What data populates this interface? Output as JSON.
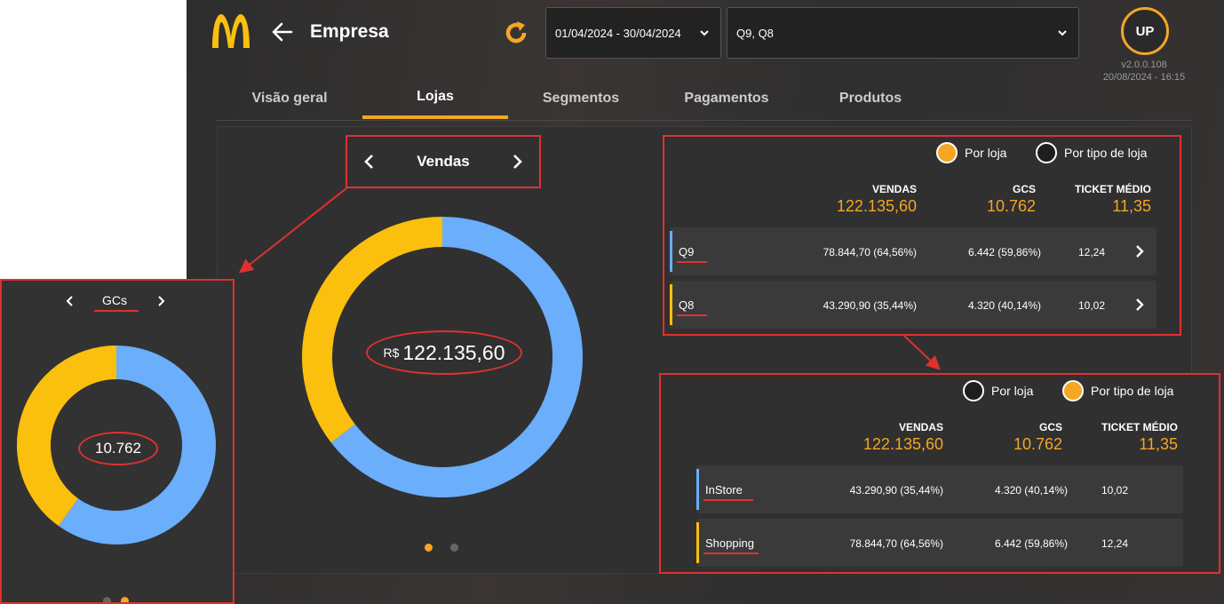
{
  "header": {
    "title": "Empresa",
    "date_range": "01/04/2024 - 30/04/2024",
    "stores": "Q9, Q8",
    "avatar": "UP",
    "version": "v2.0.0.108",
    "timestamp": "20/08/2024 - 16:15"
  },
  "tabs": [
    {
      "label": "Visão geral"
    },
    {
      "label": "Lojas"
    },
    {
      "label": "Segmentos"
    },
    {
      "label": "Pagamentos"
    },
    {
      "label": "Produtos"
    }
  ],
  "metric": {
    "label": "Vendas",
    "currency": "R$",
    "total": "122.135,60"
  },
  "inset": {
    "label": "GCs",
    "total": "10.762"
  },
  "chart_data": [
    {
      "type": "pie",
      "categories": [
        "Q9",
        "Q8"
      ],
      "values": [
        64.56,
        35.44
      ],
      "colors": [
        "#6aaefc",
        "#fbbf0e"
      ]
    },
    {
      "type": "pie",
      "categories": [
        "Q9",
        "Q8"
      ],
      "values": [
        59.86,
        40.14
      ],
      "colors": [
        "#6aaefc",
        "#fbbf0e"
      ]
    }
  ],
  "radios": {
    "por_loja": "Por loja",
    "por_tipo": "Por tipo de loja"
  },
  "columns": {
    "vendas": "VENDAS",
    "gcs": "GCS",
    "ticket": "TICKET MÉDIO"
  },
  "totals": {
    "vendas": "122.135,60",
    "gcs": "10.762",
    "ticket": "11,35"
  },
  "by_store": [
    {
      "name": "Q9",
      "vendas": "78.844,70 (64,56%)",
      "gcs": "6.442 (59,86%)",
      "ticket": "12,24",
      "color": "#6aaefc"
    },
    {
      "name": "Q8",
      "vendas": "43.290,90 (35,44%)",
      "gcs": "4.320 (40,14%)",
      "ticket": "10,02",
      "color": "#fbbf0e"
    }
  ],
  "by_type": [
    {
      "name": "InStore",
      "vendas": "43.290,90 (35,44%)",
      "gcs": "4.320 (40,14%)",
      "ticket": "10,02",
      "color": "#6aaefc"
    },
    {
      "name": "Shopping",
      "vendas": "78.844,70 (64,56%)",
      "gcs": "6.442 (59,86%)",
      "ticket": "12,24",
      "color": "#fbbf0e"
    }
  ],
  "colors": {
    "accent": "#f5a623",
    "highlight": "#e03030"
  }
}
